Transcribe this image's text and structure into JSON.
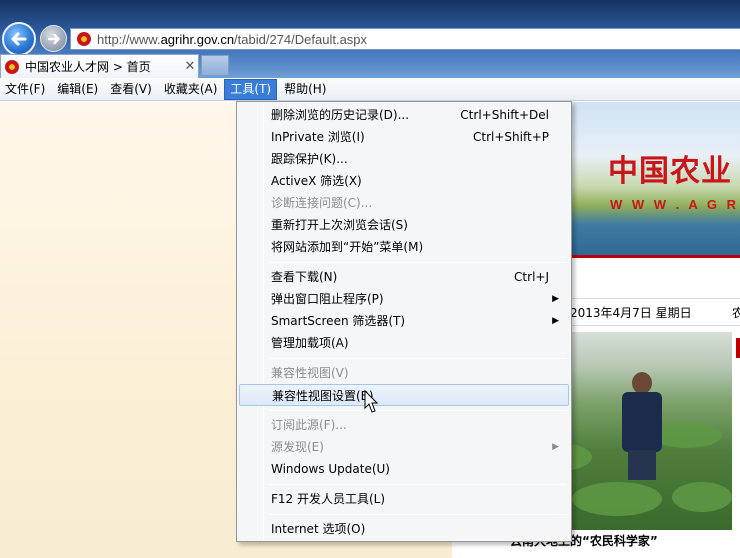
{
  "browser": {
    "address_prefix": "http://www.",
    "address_host": "agrihr.gov.cn",
    "address_path": "/tabid/274/Default.aspx",
    "tab_label": "中国农业人才网 > 首页",
    "tab_close": "✕"
  },
  "menu_bar": {
    "items": [
      "文件(F)",
      "编辑(E)",
      "查看(V)",
      "收藏夹(A)",
      "工具(T)",
      "帮助(H)"
    ]
  },
  "tools_menu": {
    "items": [
      {
        "label": "删除浏览的历史记录(D)...",
        "shortcut": "Ctrl+Shift+Del"
      },
      {
        "label": "InPrivate 浏览(I)",
        "shortcut": "Ctrl+Shift+P"
      },
      {
        "label": "跟踪保护(K)..."
      },
      {
        "label": "ActiveX 筛选(X)"
      },
      {
        "label": "诊断连接问题(C)...",
        "disabled": true
      },
      {
        "label": "重新打开上次浏览会话(S)"
      },
      {
        "label": "将网站添加到“开始”菜单(M)"
      },
      {
        "label": "查看下载(N)",
        "shortcut": "Ctrl+J"
      },
      {
        "label": "弹出窗口阻止程序(P)",
        "submenu": true
      },
      {
        "label": "SmartScreen 筛选器(T)",
        "submenu": true
      },
      {
        "label": "管理加载项(A)"
      },
      {
        "label": "兼容性视图(V)",
        "disabled": true
      },
      {
        "label": "兼容性视图设置(B)",
        "hover": true
      },
      {
        "label": "订阅此源(F)...",
        "disabled": true
      },
      {
        "label": "源发现(E)",
        "disabled": true,
        "submenu": true
      },
      {
        "label": "Windows Update(U)"
      },
      {
        "label": "F12 开发人员工具(L)"
      },
      {
        "label": "Internet 选项(O)"
      }
    ]
  },
  "page": {
    "banner_title": "中国农业",
    "banner_subtitle": "W W W . A G R I",
    "date": "2013年4月7日  星期日",
    "date_extra": "农",
    "caption": "云南大地上的“农民科学家”"
  },
  "colors": {
    "accent": "#3a7dd8",
    "brand_red": "#c8161d"
  }
}
